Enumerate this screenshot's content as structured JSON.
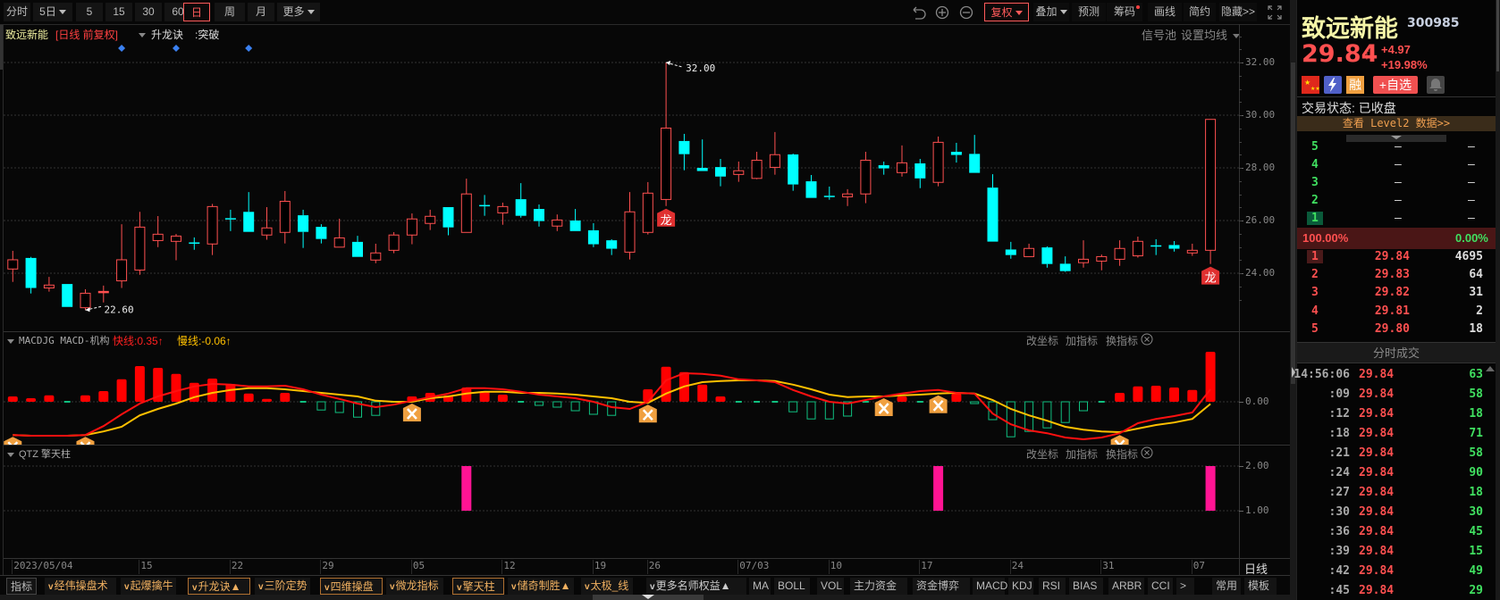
{
  "toolbar": {
    "periods": [
      {
        "label": "分时",
        "dropdown": false,
        "active": false
      },
      {
        "label": "5日",
        "dropdown": true,
        "active": false
      },
      {
        "label": "5",
        "dropdown": false,
        "active": false
      },
      {
        "label": "15",
        "dropdown": false,
        "active": false
      },
      {
        "label": "30",
        "dropdown": false,
        "active": false
      },
      {
        "label": "60",
        "dropdown": false,
        "active": false
      },
      {
        "label": "日",
        "dropdown": false,
        "active": true
      },
      {
        "label": "周",
        "dropdown": false,
        "active": false
      },
      {
        "label": "月",
        "dropdown": false,
        "active": false
      },
      {
        "label": "更多",
        "dropdown": true,
        "active": false
      }
    ],
    "right": [
      {
        "label": "复权",
        "dropdown": true,
        "active": true
      },
      {
        "label": "叠加",
        "dropdown": true,
        "active": false
      },
      {
        "label": "预测",
        "dropdown": false,
        "active": false
      },
      {
        "label": "筹码",
        "dropdown": false,
        "active": false,
        "dot": true
      },
      {
        "label": "画线",
        "dropdown": false,
        "active": false
      },
      {
        "label": "简约",
        "dropdown": false,
        "active": false
      },
      {
        "label": "隐藏>>",
        "dropdown": false,
        "active": false
      }
    ],
    "icons": [
      "undo-icon",
      "zoom-in-icon",
      "zoom-out-icon",
      "fullscreen-icon"
    ]
  },
  "chart_header": {
    "stock_name": "致远新能",
    "period_label": "[日线  前复权]",
    "indicator": "升龙诀",
    "signal": ":突破",
    "signal_pool": "信号池",
    "set_ma": "设置均线"
  },
  "macd_panel": {
    "title": "MACDJG MACD-机构",
    "fast": "快线:0.35↑",
    "slow": "慢线:-0.06↑",
    "btn_coord": "改坐标",
    "btn_add": "加指标",
    "btn_switch": "换指标"
  },
  "qtz_panel": {
    "title": "QTZ 擎天柱",
    "btn_coord": "改坐标",
    "btn_add": "加指标",
    "btn_switch": "换指标"
  },
  "axis_period": "日线",
  "bottom_toolbar": [
    {
      "label": "指标",
      "style": "plain"
    },
    {
      "label": "经伟操盘术",
      "style": "v"
    },
    {
      "label": "起爆擒牛",
      "style": "v"
    },
    {
      "label": "升龙诀▲",
      "style": "vbox"
    },
    {
      "label": "三阶定势",
      "style": "v"
    },
    {
      "label": "四维操盘",
      "style": "vbox"
    },
    {
      "label": "微龙指标",
      "style": "v"
    },
    {
      "label": "擎天柱",
      "style": "vbox"
    },
    {
      "label": "储奇制胜▲",
      "style": "v"
    },
    {
      "label": "太极_线",
      "style": "v"
    },
    {
      "label": "更多名师权益▲",
      "style": "vw"
    },
    {
      "label": "MA",
      "style": "plain"
    },
    {
      "label": "BOLL",
      "style": "plain"
    },
    {
      "label": "VOL",
      "style": "plain"
    },
    {
      "label": "主力资金",
      "style": "plain"
    },
    {
      "label": "资金博弈",
      "style": "plain"
    },
    {
      "label": "MACD",
      "style": "plain"
    },
    {
      "label": "KDJ",
      "style": "plain"
    },
    {
      "label": "RSI",
      "style": "plain"
    },
    {
      "label": "BIAS",
      "style": "plain"
    },
    {
      "label": "ARBR",
      "style": "plain"
    },
    {
      "label": "CCI",
      "style": "plain"
    },
    {
      "label": ">",
      "style": "plain"
    },
    {
      "label": "常用",
      "style": "plain"
    },
    {
      "label": "模板",
      "style": "plain"
    }
  ],
  "quote": {
    "name": "致远新能",
    "code": "300985",
    "price": "29.84",
    "arrow": "↑",
    "change": "+4.97",
    "change_pct": "+19.98%",
    "badge_rong": "融",
    "add_watch": "+自选",
    "status": "交易状态: 已收盘",
    "level2": "查看 Level2 数据>>",
    "asks": [
      {
        "n": "5",
        "p": "—",
        "v": "—"
      },
      {
        "n": "4",
        "p": "—",
        "v": "—"
      },
      {
        "n": "3",
        "p": "—",
        "v": "—"
      },
      {
        "n": "2",
        "p": "—",
        "v": "—"
      },
      {
        "n": "1",
        "p": "—",
        "v": "—"
      }
    ],
    "ratio_buy": "100.00%",
    "ratio_sell": "0.00%",
    "bids": [
      {
        "n": "1",
        "p": "29.84",
        "v": "4695"
      },
      {
        "n": "2",
        "p": "29.83",
        "v": "64"
      },
      {
        "n": "3",
        "p": "29.82",
        "v": "31"
      },
      {
        "n": "4",
        "p": "29.81",
        "v": "2"
      },
      {
        "n": "5",
        "p": "29.80",
        "v": "18"
      }
    ],
    "trades_title": "分时成交",
    "trades": [
      {
        "t": "14:56:06",
        "p": "29.84",
        "v": "63"
      },
      {
        "t": ":09",
        "p": "29.84",
        "v": "58"
      },
      {
        "t": ":12",
        "p": "29.84",
        "v": "18"
      },
      {
        "t": ":18",
        "p": "29.84",
        "v": "71"
      },
      {
        "t": ":21",
        "p": "29.84",
        "v": "58"
      },
      {
        "t": ":24",
        "p": "29.84",
        "v": "90"
      },
      {
        "t": ":27",
        "p": "29.84",
        "v": "18"
      },
      {
        "t": ":30",
        "p": "29.84",
        "v": "30"
      },
      {
        "t": ":36",
        "p": "29.84",
        "v": "45"
      },
      {
        "t": ":39",
        "p": "29.84",
        "v": "15"
      },
      {
        "t": ":42",
        "p": "29.84",
        "v": "49"
      },
      {
        "t": ":45",
        "p": "29.84",
        "v": "29"
      }
    ]
  },
  "colors": {
    "up": "#ff5050",
    "down": "#00ffff",
    "dif": "#ff1010",
    "dea": "#ffc000",
    "qtz": "#ff1493",
    "accent": "#ff5a5a"
  },
  "chart_data": {
    "type": "candlestick",
    "y_ticks": [
      32,
      30,
      28,
      26,
      24
    ],
    "y_tick_labels": [
      "32.00",
      "30.00",
      "28.00",
      "26.00",
      "24.00"
    ],
    "date_ticks": [
      {
        "i": 0,
        "label": "2023/05/04"
      },
      {
        "i": 7,
        "label": "15"
      },
      {
        "i": 12,
        "label": "22"
      },
      {
        "i": 17,
        "label": "29"
      },
      {
        "i": 22,
        "label": "05"
      },
      {
        "i": 27,
        "label": "12"
      },
      {
        "i": 32,
        "label": "19"
      },
      {
        "i": 35,
        "label": "26"
      },
      {
        "i": 40,
        "label": "07/03"
      },
      {
        "i": 45,
        "label": "10"
      },
      {
        "i": 50,
        "label": "17"
      },
      {
        "i": 55,
        "label": "24"
      },
      {
        "i": 60,
        "label": "31"
      },
      {
        "i": 65,
        "label": "07"
      }
    ],
    "ohlc": [
      [
        24.16,
        24.85,
        23.67,
        24.51
      ],
      [
        24.58,
        24.62,
        23.23,
        23.44
      ],
      [
        23.44,
        23.86,
        23.3,
        23.55
      ],
      [
        23.59,
        23.59,
        22.72,
        22.72
      ],
      [
        22.69,
        23.39,
        22.6,
        23.24
      ],
      [
        23.31,
        23.53,
        22.89,
        23.31
      ],
      [
        23.71,
        25.86,
        23.44,
        24.51
      ],
      [
        24.12,
        26.33,
        23.94,
        25.75
      ],
      [
        25.24,
        26.17,
        24.99,
        25.48
      ],
      [
        25.21,
        25.49,
        24.49,
        25.41
      ],
      [
        25.17,
        25.36,
        24.89,
        25.15
      ],
      [
        25.11,
        26.63,
        24.69,
        26.53
      ],
      [
        26.09,
        26.41,
        25.6,
        26.07
      ],
      [
        26.33,
        27.08,
        25.57,
        25.57
      ],
      [
        25.45,
        26.51,
        25.27,
        25.72
      ],
      [
        25.55,
        27.12,
        25.13,
        26.73
      ],
      [
        26.2,
        26.41,
        24.96,
        25.57
      ],
      [
        25.76,
        25.86,
        25.13,
        25.3
      ],
      [
        24.99,
        26.07,
        24.99,
        25.34
      ],
      [
        25.19,
        25.42,
        24.62,
        24.62
      ],
      [
        24.5,
        25.12,
        24.38,
        24.77
      ],
      [
        24.87,
        25.56,
        24.76,
        25.45
      ],
      [
        25.45,
        26.27,
        25.1,
        26.06
      ],
      [
        25.89,
        26.41,
        25.64,
        26.16
      ],
      [
        26.51,
        26.51,
        25.44,
        25.74
      ],
      [
        25.55,
        27.59,
        25.55,
        27.01
      ],
      [
        26.59,
        26.97,
        26.18,
        26.57
      ],
      [
        26.29,
        26.68,
        25.84,
        26.53
      ],
      [
        26.81,
        27.42,
        26.11,
        26.18
      ],
      [
        26.44,
        26.61,
        25.77,
        25.98
      ],
      [
        25.79,
        26.23,
        25.6,
        26.02
      ],
      [
        26.0,
        26.44,
        25.6,
        25.6
      ],
      [
        25.63,
        25.9,
        24.99,
        25.1
      ],
      [
        25.25,
        25.29,
        24.69,
        24.93
      ],
      [
        24.8,
        27.08,
        24.52,
        26.33
      ],
      [
        25.55,
        27.46,
        25.47,
        27.04
      ],
      [
        26.8,
        32.0,
        26.55,
        29.51
      ],
      [
        29.02,
        29.29,
        27.91,
        28.52
      ],
      [
        28.0,
        29.08,
        27.88,
        27.88
      ],
      [
        28.03,
        28.34,
        27.3,
        27.67
      ],
      [
        27.75,
        28.24,
        27.47,
        27.89
      ],
      [
        27.6,
        28.61,
        27.57,
        28.29
      ],
      [
        28.02,
        29.36,
        27.74,
        28.5
      ],
      [
        28.51,
        28.54,
        27.13,
        27.37
      ],
      [
        27.49,
        27.73,
        26.86,
        26.86
      ],
      [
        26.94,
        27.29,
        26.79,
        26.92
      ],
      [
        26.9,
        27.19,
        26.55,
        27.01
      ],
      [
        27.01,
        28.61,
        26.66,
        28.29
      ],
      [
        28.1,
        28.24,
        27.74,
        27.98
      ],
      [
        27.82,
        28.85,
        27.67,
        28.19
      ],
      [
        28.17,
        28.34,
        27.23,
        27.6
      ],
      [
        27.45,
        29.19,
        27.3,
        28.97
      ],
      [
        28.61,
        28.95,
        28.2,
        28.49
      ],
      [
        28.53,
        29.25,
        27.81,
        27.81
      ],
      [
        27.25,
        27.76,
        25.2,
        25.2
      ],
      [
        24.9,
        25.19,
        24.55,
        24.69
      ],
      [
        24.63,
        25.12,
        24.63,
        24.94
      ],
      [
        24.98,
        25.02,
        24.21,
        24.35
      ],
      [
        24.36,
        24.64,
        24.05,
        24.08
      ],
      [
        24.4,
        25.25,
        24.21,
        24.53
      ],
      [
        24.46,
        24.71,
        24.11,
        24.63
      ],
      [
        24.53,
        25.25,
        24.28,
        24.94
      ],
      [
        24.66,
        25.39,
        24.59,
        25.21
      ],
      [
        25.06,
        25.29,
        24.69,
        25.04
      ],
      [
        25.07,
        25.22,
        24.82,
        24.93
      ],
      [
        24.77,
        25.12,
        24.66,
        24.87
      ],
      [
        24.87,
        29.84,
        24.35,
        29.84
      ]
    ],
    "annotations": [
      {
        "i": 36,
        "label": "32.00",
        "at": "high"
      },
      {
        "i": 4,
        "label": "22.60",
        "at": "low"
      }
    ],
    "dragon_marks": [
      {
        "i": 36,
        "label": "龙"
      },
      {
        "i": 66,
        "label": "龙"
      }
    ],
    "signal_diamonds": [
      6,
      9,
      13
    ],
    "macd": {
      "zero_label": "0.00",
      "dif": [
        -0.93,
        -0.95,
        -0.95,
        -0.95,
        -0.93,
        -0.68,
        -0.35,
        -0.05,
        0.15,
        0.3,
        0.43,
        0.5,
        0.48,
        0.43,
        0.43,
        0.45,
        0.35,
        0.2,
        0.08,
        -0.05,
        -0.15,
        -0.08,
        0.03,
        0.13,
        0.23,
        0.38,
        0.38,
        0.35,
        0.28,
        0.2,
        0.15,
        0.1,
        0.0,
        -0.15,
        -0.2,
        0.0,
        0.6,
        0.8,
        0.78,
        0.73,
        0.63,
        0.6,
        0.55,
        0.33,
        0.15,
        0.0,
        -0.05,
        0.05,
        0.15,
        0.23,
        0.3,
        0.33,
        0.25,
        0.23,
        -0.33,
        -0.63,
        -0.8,
        -0.88,
        -1.0,
        -1.05,
        -1.0,
        -0.88,
        -0.6,
        -0.48,
        -0.4,
        -0.3,
        0.35
      ],
      "dea": [
        -0.93,
        -0.95,
        -0.95,
        -0.95,
        -0.93,
        -0.83,
        -0.7,
        -0.38,
        -0.2,
        -0.05,
        0.13,
        0.25,
        0.33,
        0.38,
        0.38,
        0.35,
        0.3,
        0.25,
        0.2,
        0.15,
        0.03,
        0.0,
        0.0,
        0.1,
        0.15,
        0.23,
        0.28,
        0.28,
        0.25,
        0.25,
        0.23,
        0.2,
        0.15,
        0.1,
        0.0,
        -0.03,
        0.23,
        0.43,
        0.55,
        0.58,
        0.6,
        0.6,
        0.58,
        0.48,
        0.35,
        0.2,
        0.13,
        0.15,
        0.15,
        0.18,
        0.2,
        0.23,
        0.25,
        0.23,
        0.05,
        -0.2,
        -0.38,
        -0.53,
        -0.7,
        -0.78,
        -0.83,
        -0.85,
        -0.75,
        -0.65,
        -0.58,
        -0.48,
        -0.06
      ],
      "hist": [
        0.15,
        0.1,
        0.18,
        -0.01,
        0.18,
        0.3,
        0.63,
        1.0,
        0.95,
        0.78,
        0.53,
        0.65,
        0.5,
        0.23,
        0.08,
        0.25,
        -0.03,
        -0.23,
        -0.3,
        -0.43,
        -0.38,
        -0.03,
        0.15,
        0.25,
        0.18,
        0.4,
        0.3,
        0.2,
        -0.03,
        -0.1,
        -0.15,
        -0.25,
        -0.35,
        -0.38,
        -0.03,
        0.35,
        0.98,
        0.83,
        0.48,
        0.15,
        -0.01,
        -0.01,
        -0.03,
        -0.28,
        -0.48,
        -0.48,
        -0.4,
        -0.03,
        0.05,
        0.15,
        -0.01,
        0.08,
        0.23,
        -0.05,
        -0.5,
        -0.98,
        -0.83,
        -0.73,
        -0.58,
        -0.25,
        -0.01,
        0.25,
        0.43,
        0.45,
        0.4,
        0.33,
        1.4
      ],
      "cross_marks": [
        0,
        4,
        22,
        35,
        48,
        51,
        61
      ]
    },
    "qtz": {
      "y_tick_labels": [
        "2.00",
        "1.00"
      ],
      "bars": [
        25,
        51,
        66
      ],
      "low": 1,
      "high": 2
    }
  }
}
